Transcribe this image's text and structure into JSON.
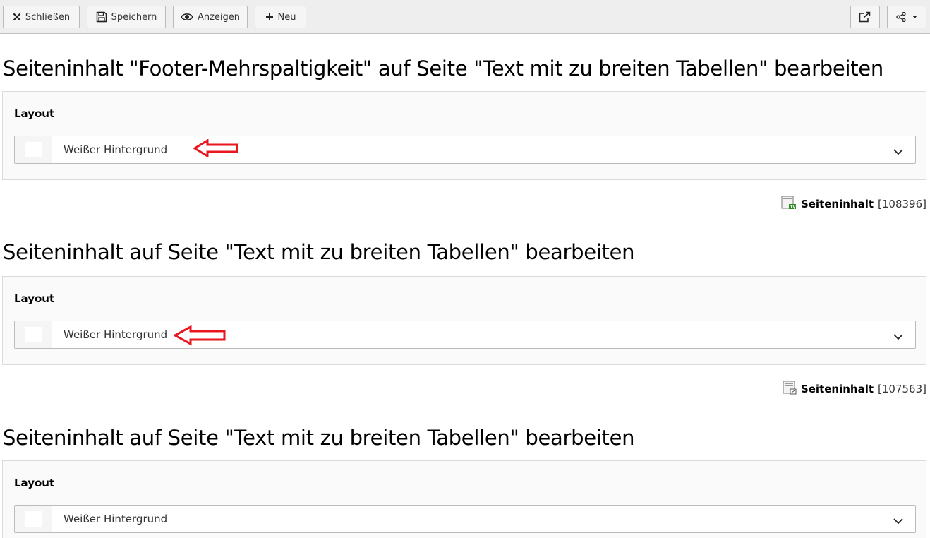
{
  "toolbar": {
    "close_label": "Schließen",
    "save_label": "Speichern",
    "view_label": "Anzeigen",
    "new_label": "Neu",
    "icons": {
      "close": "close-icon",
      "save": "floppy-disk-icon",
      "view": "eye-icon",
      "new": "plus-icon",
      "open_external": "external-link-icon",
      "share": "share-icon",
      "share_dropdown": "caret-down-icon"
    }
  },
  "sections": [
    {
      "heading": "Seiteninhalt \"Footer-Mehrspaltigkeit\" auf Seite \"Text mit zu breiten Tabellen\" bearbeiten",
      "field_label": "Layout",
      "select_value": "Weißer Hintergrund",
      "swatch_color": "#ffffff",
      "record_label": "Seiteninhalt",
      "record_id": "[108396]",
      "record_icon": "content-element-tv-icon",
      "annotated": true
    },
    {
      "heading": "Seiteninhalt auf Seite \"Text mit zu breiten Tabellen\" bearbeiten",
      "field_label": "Layout",
      "select_value": "Weißer Hintergrund",
      "swatch_color": "#ffffff",
      "record_label": "Seiteninhalt",
      "record_id": "[107563]",
      "record_icon": "content-element-icon",
      "annotated": true
    },
    {
      "heading": "Seiteninhalt auf Seite \"Text mit zu breiten Tabellen\" bearbeiten",
      "field_label": "Layout",
      "select_value": "Weißer Hintergrund",
      "swatch_color": "#ffffff",
      "annotated": false
    }
  ],
  "colors": {
    "toolbar_bg": "#eeeeee",
    "panel_bg": "#fafafa",
    "annotation_arrow": "#e8161d",
    "tv_badge": "#2e8b24"
  }
}
